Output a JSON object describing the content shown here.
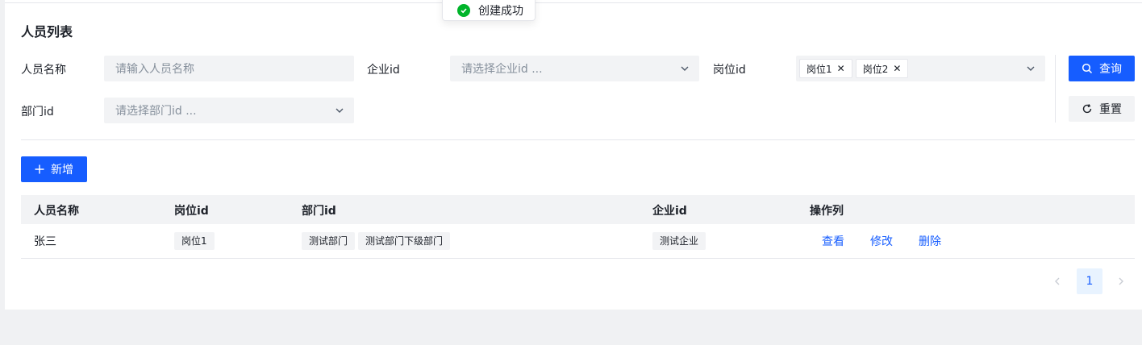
{
  "toast": {
    "text": "创建成功"
  },
  "section_title": "人员列表",
  "filters": {
    "name_label": "人员名称",
    "name_placeholder": "请输入人员名称",
    "company_label": "企业id",
    "company_placeholder": "请选择企业id ...",
    "position_label": "岗位id",
    "position_tags": [
      "岗位1",
      "岗位2"
    ],
    "dept_label": "部门id",
    "dept_placeholder": "请选择部门id ..."
  },
  "actions": {
    "query_label": "查询",
    "reset_label": "重置",
    "add_label": "新增"
  },
  "table": {
    "columns": [
      "人员名称",
      "岗位id",
      "部门id",
      "企业id",
      "操作列"
    ],
    "rows": [
      {
        "name": "张三",
        "positions": [
          "岗位1"
        ],
        "departments": [
          "测试部门",
          "测试部门下级部门"
        ],
        "company": "测试企业",
        "ops": [
          "查看",
          "修改",
          "删除"
        ]
      }
    ]
  },
  "pagination": {
    "current": "1"
  },
  "colors": {
    "primary": "#165dff",
    "success": "#00b42a",
    "fill": "#f2f3f5"
  }
}
